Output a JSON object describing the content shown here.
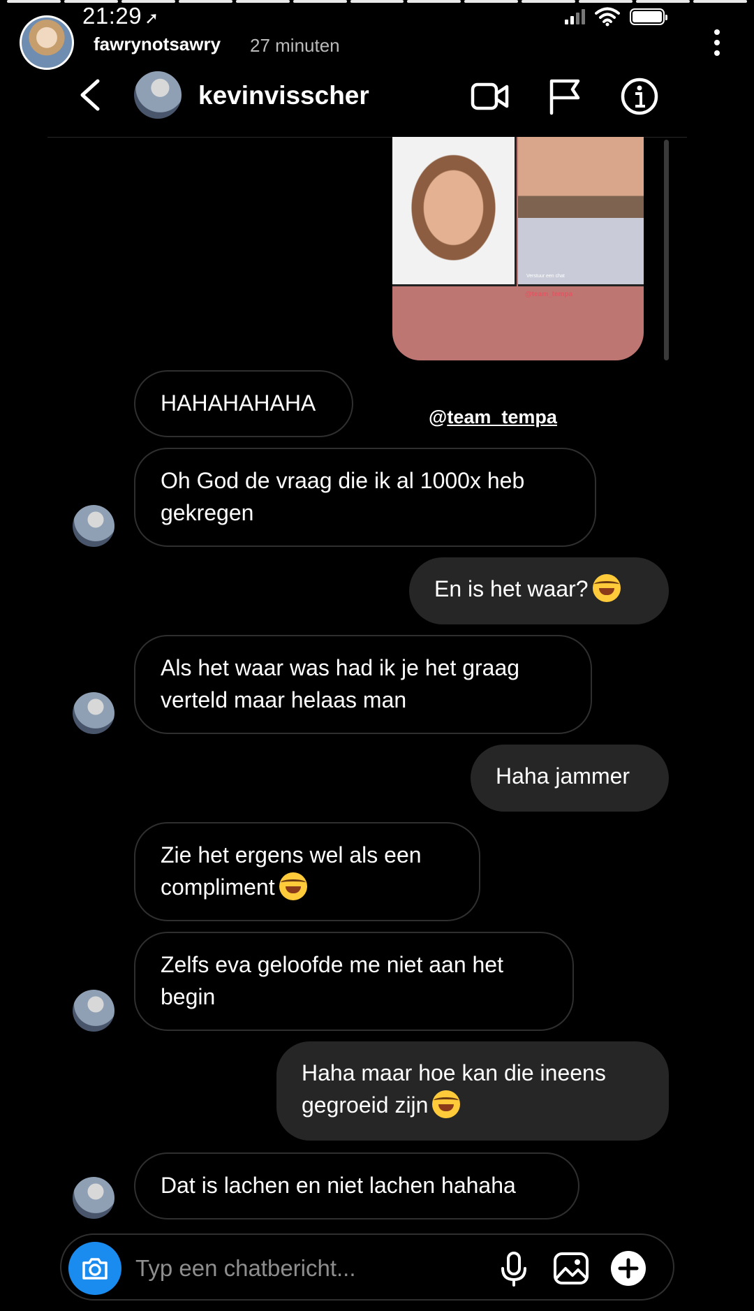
{
  "status_bar": {
    "time": "21:29",
    "location_icon": "location-arrow-icon"
  },
  "story": {
    "username": "fawrynotsawry",
    "time_ago": "27 minuten",
    "segments": 13
  },
  "dm_header": {
    "username": "kevinvisscher",
    "icons": [
      "video-call-icon",
      "flag-icon",
      "info-icon"
    ]
  },
  "shared_story": {
    "tag": "@team_tempa",
    "caption": "Verstuur een chat"
  },
  "sticker": {
    "prefix": "@",
    "handle": "team_tempa"
  },
  "messages": [
    {
      "dir": "in",
      "text": "HAHAHAHAHA"
    },
    {
      "dir": "in",
      "text": "Oh God de vraag die ik al 1000x heb gekregen"
    },
    {
      "dir": "out",
      "text": "En is het waar?",
      "emoji": "tears-of-joy-emoji"
    },
    {
      "dir": "in",
      "text": "Als het waar was had ik je het graag verteld maar helaas man"
    },
    {
      "dir": "out",
      "text": "Haha jammer"
    },
    {
      "dir": "in",
      "text": "Zie het ergens wel als een compliment",
      "emoji": "tears-of-joy-emoji"
    },
    {
      "dir": "in",
      "text": "Zelfs eva geloofde me niet aan het begin"
    },
    {
      "dir": "out",
      "text": "Haha maar hoe kan die ineens gegroeid zijn",
      "emoji": "tears-of-joy-emoji"
    },
    {
      "dir": "in",
      "text": "Dat is lachen en niet lachen hahaha"
    }
  ],
  "composer": {
    "placeholder": "Typ een chatbericht..."
  },
  "colors": {
    "background": "#000000",
    "outgoing_bubble": "#262626",
    "camera_button": "#1a8cf0",
    "incoming_border": "#2f2f2f"
  }
}
